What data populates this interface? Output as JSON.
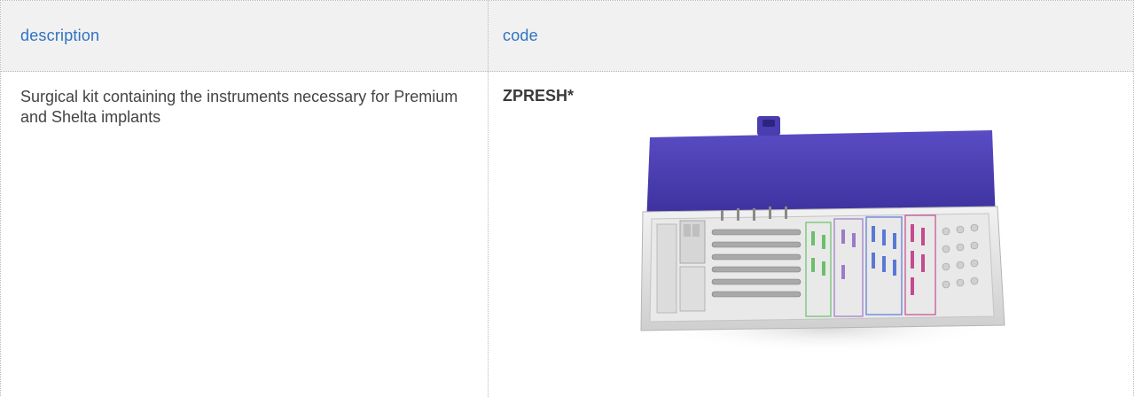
{
  "table": {
    "headers": {
      "description": "description",
      "code": "code"
    },
    "rows": [
      {
        "description": "Surgical kit containing the instruments necessary for Premium and Shelta implants",
        "code": "ZPRESH*",
        "image_icon": "surgical-kit-image"
      }
    ]
  },
  "colors": {
    "header_bg": "#f1f1f1",
    "header_text": "#2f72c0",
    "lid": "#4a3db0",
    "tray": "#e6e6e6"
  }
}
